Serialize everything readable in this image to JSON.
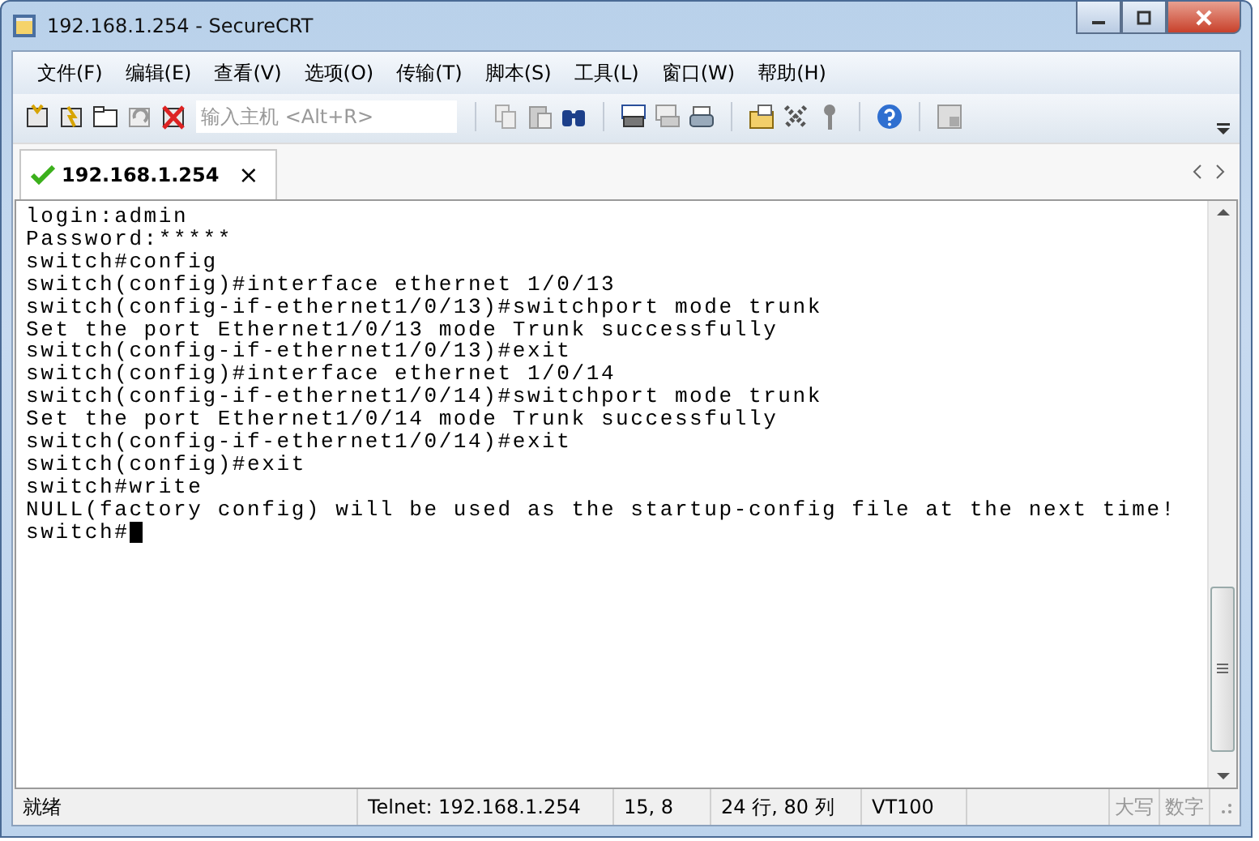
{
  "window": {
    "title": "192.168.1.254 - SecureCRT"
  },
  "menu": [
    "文件(F)",
    "编辑(E)",
    "查看(V)",
    "选项(O)",
    "传输(T)",
    "脚本(S)",
    "工具(L)",
    "窗口(W)",
    "帮助(H)"
  ],
  "toolbar": {
    "host_field": {
      "placeholder": "输入主机 <Alt+R>"
    }
  },
  "tabs": [
    {
      "label": "192.168.1.254",
      "selected": true,
      "connected": true,
      "close": "×"
    }
  ],
  "terminal": {
    "lines": [
      "login:admin",
      "Password:*****",
      "switch#config",
      "switch(config)#interface ethernet 1/0/13",
      "switch(config-if-ethernet1/0/13)#switchport mode trunk",
      "Set the port Ethernet1/0/13 mode Trunk successfully",
      "switch(config-if-ethernet1/0/13)#exit",
      "switch(config)#interface ethernet 1/0/14",
      "switch(config-if-ethernet1/0/14)#switchport mode trunk",
      "Set the port Ethernet1/0/14 mode Trunk successfully",
      "switch(config-if-ethernet1/0/14)#exit",
      "switch(config)#exit",
      "switch#write",
      "NULL(factory config) will be used as the startup-config file at the next time!",
      "switch#"
    ],
    "cursor": true
  },
  "status_bar": {
    "status": "就绪",
    "connection": "Telnet: 192.168.1.254",
    "position": "15,   8",
    "size": "24 行, 80 列",
    "emulation": "VT100",
    "indicators": [
      {
        "label": "大写",
        "disabled": true
      },
      {
        "label": "数字",
        "disabled": true
      }
    ]
  }
}
